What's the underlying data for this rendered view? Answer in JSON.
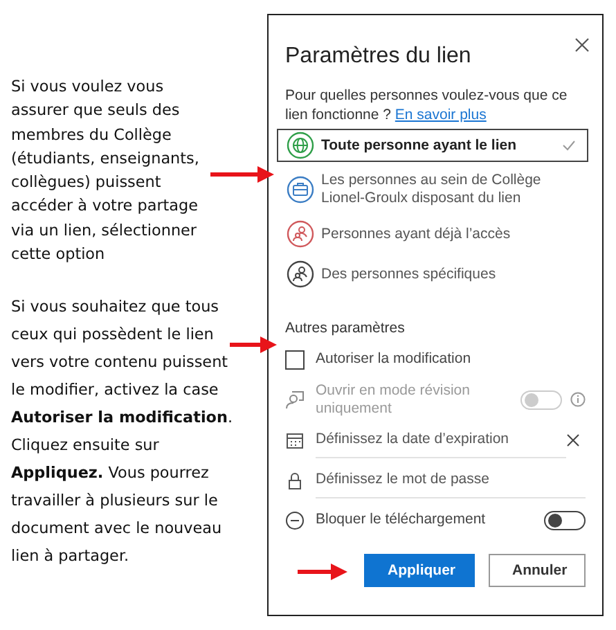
{
  "instructions": [
    "Si vous voulez vous assurer que seuls des membres du Collège (étudiants, enseignants, collègues) puissent accéder à votre partage via un lien, sélectionner cette option",
    "Si vous souhaitez que tous ceux qui possèdent le lien vers votre contenu puissent le modifier, activez la case **Autoriser la modification**. Cliquez ensuite sur **Appliquez.** Vous pourrez travailler à plusieurs sur le document avec le nouveau lien à partager."
  ],
  "dialog": {
    "title": "Paramètres du lien",
    "question": "Pour quelles personnes voulez-vous que ce lien fonctionne ?",
    "learn_more": "En savoir plus",
    "options": [
      {
        "label": "Toute personne ayant le lien",
        "selected": true,
        "color": "#2e9e48"
      },
      {
        "label": "Les personnes au sein de Collège Lionel-Groulx disposant du lien",
        "selected": false,
        "color": "#3b7dc4"
      },
      {
        "label": "Personnes ayant déjà l’accès",
        "selected": false,
        "color": "#d0595c"
      },
      {
        "label": "Des personnes spécifiques",
        "selected": false,
        "color": "#444444"
      }
    ],
    "other_title": "Autres paramètres",
    "settings": [
      {
        "kind": "checkbox",
        "label": "Autoriser la modification",
        "checked": false
      },
      {
        "kind": "toggle",
        "label": "Ouvrir en mode révision uniquement",
        "on": false,
        "disabled": true
      },
      {
        "kind": "field",
        "placeholder": "Définissez la date d’expiration"
      },
      {
        "kind": "field",
        "placeholder": "Définissez le mot de passe"
      },
      {
        "kind": "toggle",
        "label": "Bloquer le téléchargement",
        "on": false,
        "disabled": false
      }
    ],
    "buttons": [
      {
        "label": "Appliquer",
        "primary": true
      },
      {
        "label": "Annuler",
        "primary": false
      }
    ]
  }
}
